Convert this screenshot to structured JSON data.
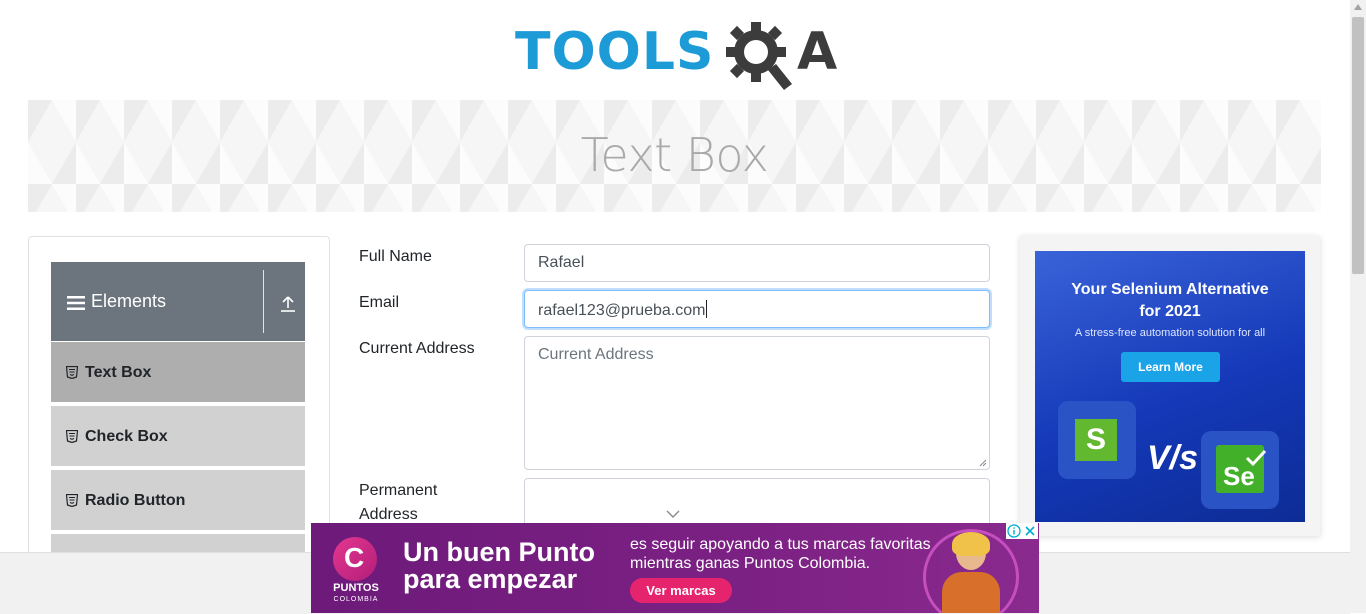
{
  "logo": {
    "tools": "TOOLS",
    "a": "A"
  },
  "banner": {
    "title": "Text Box"
  },
  "sidebar": {
    "group_title": "Elements",
    "items": [
      {
        "label": "Text Box",
        "active": true
      },
      {
        "label": "Check Box",
        "active": false
      },
      {
        "label": "Radio Button",
        "active": false
      }
    ]
  },
  "form": {
    "full_name": {
      "label": "Full Name",
      "value": "Rafael"
    },
    "email": {
      "label": "Email",
      "value": "rafael123@prueba.com"
    },
    "current_address": {
      "label": "Current Address",
      "placeholder": "Current Address",
      "value": ""
    },
    "permanent_address": {
      "label_line1": "Permanent",
      "label_line2": "Address",
      "value": ""
    }
  },
  "right_ad": {
    "headline_line1": "Your Selenium Alternative",
    "headline_line2": "for 2021",
    "subtitle": "A stress-free automation solution for all",
    "button": "Learn More",
    "logo_left_letter": "S",
    "vs": "V/s",
    "logo_right_letter": "Se"
  },
  "bottom_ad": {
    "logo_letter": "C",
    "logo_brand": "PUNTOS",
    "logo_sub": "COLOMBIA",
    "headline_line1": "Un buen Punto",
    "headline_line2": "para empezar",
    "text_line1": "es seguir apoyando a tus marcas favoritas",
    "text_line2": "mientras ganas Puntos Colombia.",
    "button": "Ver marcas"
  },
  "colors": {
    "brand_blue": "#1c9bd7",
    "sidebar_header": "#6c757d",
    "active_item": "#aeaeae",
    "focus_border": "#80bdff"
  }
}
